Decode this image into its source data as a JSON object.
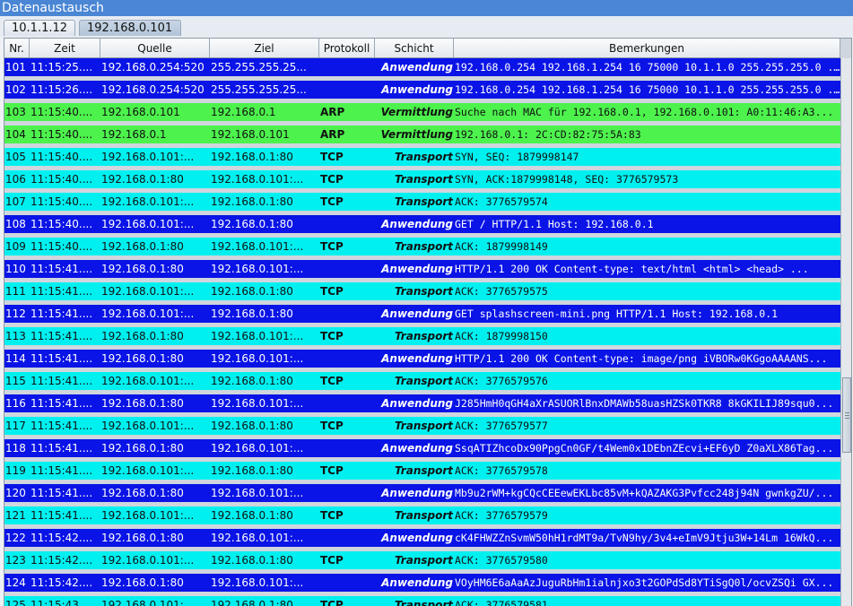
{
  "window": {
    "title": "Datenaustausch"
  },
  "tabs": [
    {
      "label": "10.1.1.12",
      "selected": false
    },
    {
      "label": "192.168.0.101",
      "selected": true
    }
  ],
  "columns": {
    "nr": "Nr.",
    "zeit": "Zeit",
    "quelle": "Quelle",
    "ziel": "Ziel",
    "protokoll": "Protokoll",
    "schicht": "Schicht",
    "bemerkungen": "Bemerkungen"
  },
  "colors": {
    "application": "#0a14e6",
    "network": "#4df24d",
    "transport": "#00f0f0"
  },
  "rows": [
    {
      "nr": "101",
      "zeit": "11:15:25....",
      "quelle": "192.168.0.254:520",
      "ziel": "255.255.255.25...",
      "protokoll": "",
      "schicht": "Anwendung",
      "bem": "192.168.0.254 192.168.1.254 16 75000 10.1.1.0 255.255.255.0 ...",
      "color": "blue"
    },
    {
      "nr": "102",
      "zeit": "11:15:26....",
      "quelle": "192.168.0.254:520",
      "ziel": "255.255.255.25...",
      "protokoll": "",
      "schicht": "Anwendung",
      "bem": "192.168.0.254 192.168.1.254 16 75000 10.1.1.0 255.255.255.0 ...",
      "color": "blue"
    },
    {
      "nr": "103",
      "zeit": "11:15:40....",
      "quelle": "192.168.0.101",
      "ziel": "192.168.0.1",
      "protokoll": "ARP",
      "schicht": "Vermittlung",
      "bem": "Suche nach MAC für 192.168.0.1, 192.168.0.101: A0:11:46:A3...",
      "color": "green"
    },
    {
      "nr": "104",
      "zeit": "11:15:40....",
      "quelle": "192.168.0.1",
      "ziel": "192.168.0.101",
      "protokoll": "ARP",
      "schicht": "Vermittlung",
      "bem": "192.168.0.1: 2C:CD:82:75:5A:83",
      "color": "green"
    },
    {
      "nr": "105",
      "zeit": "11:15:40....",
      "quelle": "192.168.0.101:...",
      "ziel": "192.168.0.1:80",
      "protokoll": "TCP",
      "schicht": "Transport",
      "bem": "SYN, SEQ: 1879998147",
      "color": "cyan"
    },
    {
      "nr": "106",
      "zeit": "11:15:40....",
      "quelle": "192.168.0.1:80",
      "ziel": "192.168.0.101:...",
      "protokoll": "TCP",
      "schicht": "Transport",
      "bem": "SYN, ACK:1879998148, SEQ: 3776579573",
      "color": "cyan"
    },
    {
      "nr": "107",
      "zeit": "11:15:40....",
      "quelle": "192.168.0.101:...",
      "ziel": "192.168.0.1:80",
      "protokoll": "TCP",
      "schicht": "Transport",
      "bem": "ACK: 3776579574",
      "color": "cyan"
    },
    {
      "nr": "108",
      "zeit": "11:15:40....",
      "quelle": "192.168.0.101:...",
      "ziel": "192.168.0.1:80",
      "protokoll": "",
      "schicht": "Anwendung",
      "bem": "GET / HTTP/1.1 Host: 192.168.0.1",
      "color": "blue"
    },
    {
      "nr": "109",
      "zeit": "11:15:40....",
      "quelle": "192.168.0.1:80",
      "ziel": "192.168.0.101:...",
      "protokoll": "TCP",
      "schicht": "Transport",
      "bem": "ACK: 1879998149",
      "color": "cyan"
    },
    {
      "nr": "110",
      "zeit": "11:15:41....",
      "quelle": "192.168.0.1:80",
      "ziel": "192.168.0.101:...",
      "protokoll": "",
      "schicht": "Anwendung",
      "bem": "HTTP/1.1 200 OK Content-type: text/html  <html>   <head>  ...",
      "color": "blue"
    },
    {
      "nr": "111",
      "zeit": "11:15:41....",
      "quelle": "192.168.0.101:...",
      "ziel": "192.168.0.1:80",
      "protokoll": "TCP",
      "schicht": "Transport",
      "bem": "ACK: 3776579575",
      "color": "cyan"
    },
    {
      "nr": "112",
      "zeit": "11:15:41....",
      "quelle": "192.168.0.101:...",
      "ziel": "192.168.0.1:80",
      "protokoll": "",
      "schicht": "Anwendung",
      "bem": "GET splashscreen-mini.png HTTP/1.1 Host: 192.168.0.1",
      "color": "blue"
    },
    {
      "nr": "113",
      "zeit": "11:15:41....",
      "quelle": "192.168.0.1:80",
      "ziel": "192.168.0.101:...",
      "protokoll": "TCP",
      "schicht": "Transport",
      "bem": "ACK: 1879998150",
      "color": "cyan"
    },
    {
      "nr": "114",
      "zeit": "11:15:41....",
      "quelle": "192.168.0.1:80",
      "ziel": "192.168.0.101:...",
      "protokoll": "",
      "schicht": "Anwendung",
      "bem": "HTTP/1.1 200 OK Content-type: image/png  iVBORw0KGgoAAAANS...",
      "color": "blue"
    },
    {
      "nr": "115",
      "zeit": "11:15:41....",
      "quelle": "192.168.0.101:...",
      "ziel": "192.168.0.1:80",
      "protokoll": "TCP",
      "schicht": "Transport",
      "bem": "ACK: 3776579576",
      "color": "cyan"
    },
    {
      "nr": "116",
      "zeit": "11:15:41....",
      "quelle": "192.168.0.1:80",
      "ziel": "192.168.0.101:...",
      "protokoll": "",
      "schicht": "Anwendung",
      "bem": "J285HmH0qGH4aXrASUORlBnxDMAWb58uasHZSk0TKR8 8kGKILIJ89squ0...",
      "color": "blue"
    },
    {
      "nr": "117",
      "zeit": "11:15:41....",
      "quelle": "192.168.0.101:...",
      "ziel": "192.168.0.1:80",
      "protokoll": "TCP",
      "schicht": "Transport",
      "bem": "ACK: 3776579577",
      "color": "cyan"
    },
    {
      "nr": "118",
      "zeit": "11:15:41....",
      "quelle": "192.168.0.1:80",
      "ziel": "192.168.0.101:...",
      "protokoll": "",
      "schicht": "Anwendung",
      "bem": "SsqATIZhcoDx90PpgCn0GF/t4Wem0x1DEbnZEcvi+EF6yD Z0aXLX86Tag...",
      "color": "blue"
    },
    {
      "nr": "119",
      "zeit": "11:15:41....",
      "quelle": "192.168.0.101:...",
      "ziel": "192.168.0.1:80",
      "protokoll": "TCP",
      "schicht": "Transport",
      "bem": "ACK: 3776579578",
      "color": "cyan"
    },
    {
      "nr": "120",
      "zeit": "11:15:41....",
      "quelle": "192.168.0.1:80",
      "ziel": "192.168.0.101:...",
      "protokoll": "",
      "schicht": "Anwendung",
      "bem": "Mb9u2rWM+kgCQcCEEewEKLbc85vM+kQAZAKG3Pvfcc248j94N gwnkgZU/...",
      "color": "blue"
    },
    {
      "nr": "121",
      "zeit": "11:15:41....",
      "quelle": "192.168.0.101:...",
      "ziel": "192.168.0.1:80",
      "protokoll": "TCP",
      "schicht": "Transport",
      "bem": "ACK: 3776579579",
      "color": "cyan"
    },
    {
      "nr": "122",
      "zeit": "11:15:42....",
      "quelle": "192.168.0.1:80",
      "ziel": "192.168.0.101:...",
      "protokoll": "",
      "schicht": "Anwendung",
      "bem": "cK4FHWZZnSvmW50hH1rdMT9a/TvN9hy/3v4+eImV9Jtju3W+14Lm 16WkQ...",
      "color": "blue"
    },
    {
      "nr": "123",
      "zeit": "11:15:42....",
      "quelle": "192.168.0.101:...",
      "ziel": "192.168.0.1:80",
      "protokoll": "TCP",
      "schicht": "Transport",
      "bem": "ACK: 3776579580",
      "color": "cyan"
    },
    {
      "nr": "124",
      "zeit": "11:15:42....",
      "quelle": "192.168.0.1:80",
      "ziel": "192.168.0.101:...",
      "protokoll": "",
      "schicht": "Anwendung",
      "bem": "VOyHM6E6aAaAzJuguRbHm1ialnjxo3t2GOPdSd8YTiSgQ0l/ocvZSQi GX...",
      "color": "blue"
    },
    {
      "nr": "125",
      "zeit": "11:15:43....",
      "quelle": "192.168.0.101:...",
      "ziel": "192.168.0.1:80",
      "protokoll": "TCP",
      "schicht": "Transport",
      "bem": "ACK: 3776579581",
      "color": "cyan"
    }
  ]
}
